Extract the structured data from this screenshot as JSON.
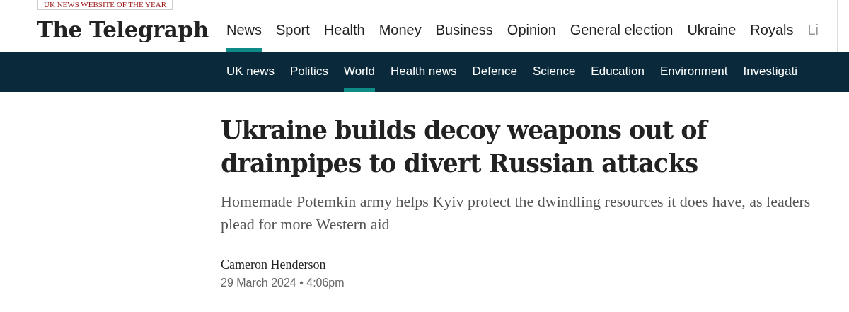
{
  "award_badge": "UK NEWS WEBSITE OF THE YEAR",
  "logo": "The Telegraph",
  "primary_nav": [
    {
      "label": "News",
      "selected": true,
      "faded": false
    },
    {
      "label": "Sport",
      "selected": false,
      "faded": false
    },
    {
      "label": "Health",
      "selected": false,
      "faded": false
    },
    {
      "label": "Money",
      "selected": false,
      "faded": false
    },
    {
      "label": "Business",
      "selected": false,
      "faded": false
    },
    {
      "label": "Opinion",
      "selected": false,
      "faded": false
    },
    {
      "label": "General election",
      "selected": false,
      "faded": false
    },
    {
      "label": "Ukraine",
      "selected": false,
      "faded": false
    },
    {
      "label": "Royals",
      "selected": false,
      "faded": false
    },
    {
      "label": "Li",
      "selected": false,
      "faded": true
    }
  ],
  "secondary_nav": [
    {
      "label": "UK news",
      "selected": false
    },
    {
      "label": "Politics",
      "selected": false
    },
    {
      "label": "World",
      "selected": true
    },
    {
      "label": "Health news",
      "selected": false
    },
    {
      "label": "Defence",
      "selected": false
    },
    {
      "label": "Science",
      "selected": false
    },
    {
      "label": "Education",
      "selected": false
    },
    {
      "label": "Environment",
      "selected": false
    },
    {
      "label": "Investigati",
      "selected": false
    }
  ],
  "article": {
    "headline": "Ukraine builds decoy weapons out of drainpipes to divert Russian attacks",
    "standfirst": "Homemade Potemkin army helps Kyiv protect the dwindling resources it does have, as leaders plead for more Western aid",
    "author": "Cameron Henderson",
    "date": "29 March 2024 • 4:06pm"
  }
}
